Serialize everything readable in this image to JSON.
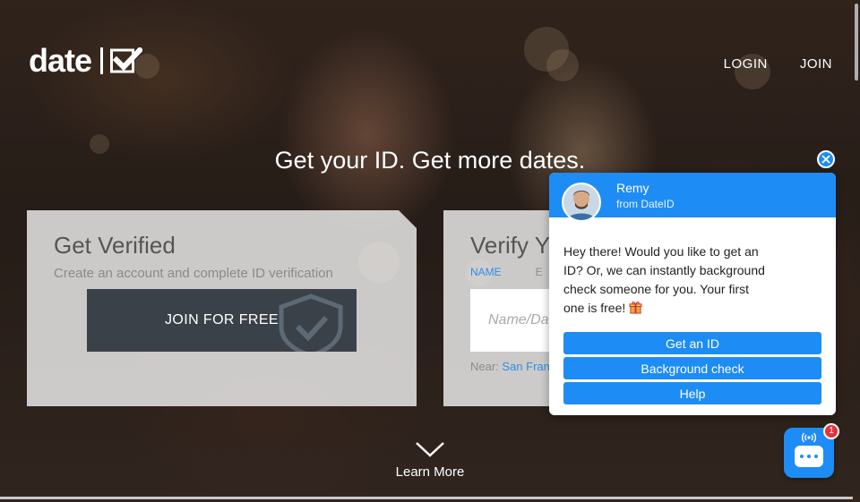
{
  "brand": {
    "logo_text": "date"
  },
  "nav": {
    "login": "LOGIN",
    "join": "JOIN"
  },
  "hero": {
    "tagline": "Get your ID. Get more dates."
  },
  "get_verified": {
    "title": "Get Verified",
    "subtitle": "Create an account and complete ID verification",
    "join_button": "JOIN FOR FREE"
  },
  "verify": {
    "title": "Verify Y",
    "tab_name": "NAME",
    "tab_other": "E",
    "name_placeholder": "Name/Da",
    "near_label": "Near:",
    "near_location": "San Fran"
  },
  "learn_more": {
    "label": "Learn More"
  },
  "chat": {
    "agent_name": "Remy",
    "agent_from": "from DateID",
    "message": "Hey there! Would you like to get an ID? Or, we can instantly background check someone for you. Your first one is free!",
    "actions": [
      "Get an ID",
      "Background check",
      "Help"
    ],
    "unread_count": "1"
  },
  "colors": {
    "accent": "#1e8cf5",
    "join_button_bg": "#3a4148",
    "badge": "#e8313b",
    "link": "#2d8ee8"
  },
  "icons": {
    "logo_check": "checkmark-icon",
    "shield": "shield-check-icon",
    "learn_more": "chevron-down-icon",
    "close": "close-icon",
    "launcher": "chat-bubble-icon",
    "gift": "gift-icon"
  }
}
